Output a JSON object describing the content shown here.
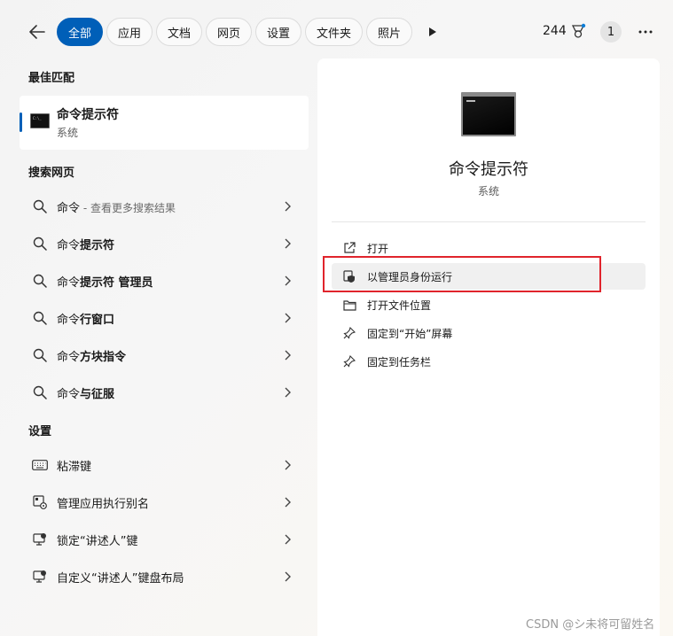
{
  "filters": [
    "全部",
    "应用",
    "文档",
    "网页",
    "设置",
    "文件夹",
    "照片"
  ],
  "top_right": {
    "points": "244",
    "badge": "1"
  },
  "best_match": {
    "title": "最佳匹配",
    "name": "命令提示符",
    "type": "系统"
  },
  "web_search": {
    "title": "搜索网页",
    "items": [
      {
        "prefix": "命令",
        "bold": "",
        "suffix": " - 查看更多搜索结果"
      },
      {
        "prefix": "命令",
        "bold": "提示符",
        "suffix": ""
      },
      {
        "prefix": "命令",
        "bold": "提示符 管理员",
        "suffix": ""
      },
      {
        "prefix": "命令",
        "bold": "行窗口",
        "suffix": ""
      },
      {
        "prefix": "命令",
        "bold": "方块指令",
        "suffix": ""
      },
      {
        "prefix": "命令",
        "bold": "与征服",
        "suffix": ""
      }
    ]
  },
  "settings": {
    "title": "设置",
    "items": [
      {
        "label": "粘滞键",
        "icon": "keyboard-icon"
      },
      {
        "label": "管理应用执行别名",
        "icon": "app-alias-icon"
      },
      {
        "label": "锁定“讲述人”键",
        "icon": "narrator-icon"
      },
      {
        "label": "自定义“讲述人”键盘布局",
        "icon": "narrator-icon"
      }
    ]
  },
  "detail": {
    "name": "命令提示符",
    "type": "系统",
    "actions": [
      {
        "label": "打开",
        "icon": "open-external-icon"
      },
      {
        "label": "以管理员身份运行",
        "icon": "shield-icon"
      },
      {
        "label": "打开文件位置",
        "icon": "folder-icon"
      },
      {
        "label": "固定到“开始”屏幕",
        "icon": "pin-icon"
      },
      {
        "label": "固定到任务栏",
        "icon": "pin-icon"
      }
    ]
  },
  "watermark": "CSDN @シ未将可留姓名",
  "colors": {
    "accent": "#005fb8",
    "highlight_border": "#e0242c"
  }
}
